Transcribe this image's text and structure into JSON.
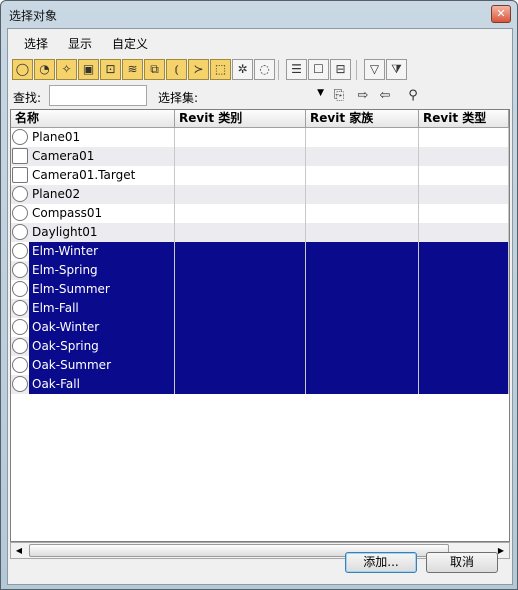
{
  "window": {
    "title": "选择对象",
    "close_glyph": "✕"
  },
  "menu": [
    "选择",
    "显示",
    "自定义"
  ],
  "toolbar": {
    "buttons": [
      {
        "icon": "geometry-icon",
        "glyph": "◯",
        "on": true
      },
      {
        "icon": "shapes-icon",
        "glyph": "◔",
        "on": true
      },
      {
        "icon": "lights-icon",
        "glyph": "✧",
        "on": true
      },
      {
        "icon": "cameras-icon",
        "glyph": "▣",
        "on": true
      },
      {
        "icon": "helpers-icon",
        "glyph": "⊡",
        "on": true
      },
      {
        "icon": "space-warps-icon",
        "glyph": "≋",
        "on": true
      },
      {
        "icon": "groups-icon",
        "glyph": "⧉",
        "on": true
      },
      {
        "icon": "xrefs-icon",
        "glyph": "⦅",
        "on": true
      },
      {
        "icon": "bones-icon",
        "glyph": "≻",
        "on": true
      },
      {
        "icon": "containers-icon",
        "glyph": "⬚",
        "on": true
      },
      {
        "icon": "frozen-icon",
        "glyph": "✲",
        "on": false
      },
      {
        "icon": "hidden-icon",
        "glyph": "◌",
        "on": false
      },
      {
        "icon": "list-all-icon",
        "glyph": "☰",
        "on": false
      },
      {
        "icon": "list-none-icon",
        "glyph": "☐",
        "on": false
      },
      {
        "icon": "list-invert-icon",
        "glyph": "⊟",
        "on": false
      },
      {
        "icon": "filter-icon",
        "glyph": "▽",
        "on": false
      },
      {
        "icon": "filter-options-icon",
        "glyph": "⧩",
        "on": false
      }
    ]
  },
  "filter": {
    "find_label": "查找:",
    "find_value": "",
    "selset_label": "选择集:",
    "selset_value": ""
  },
  "columns": [
    "名称",
    "Revit 类别",
    "Revit 家族",
    "Revit 类型"
  ],
  "rows": [
    {
      "name": "Plane01",
      "icon": "geometry-icon",
      "selected": false
    },
    {
      "name": "Camera01",
      "icon": "camera-icon",
      "selected": false
    },
    {
      "name": "Camera01.Target",
      "icon": "camera-target-icon",
      "selected": false
    },
    {
      "name": "Plane02",
      "icon": "geometry-icon",
      "selected": false
    },
    {
      "name": "Compass01",
      "icon": "helper-icon",
      "selected": false
    },
    {
      "name": "Daylight01",
      "icon": "group-icon",
      "selected": false
    },
    {
      "name": "Elm-Winter",
      "icon": "geometry-icon",
      "selected": true
    },
    {
      "name": "Elm-Spring",
      "icon": "geometry-icon",
      "selected": true
    },
    {
      "name": "Elm-Summer",
      "icon": "geometry-icon",
      "selected": true
    },
    {
      "name": "Elm-Fall",
      "icon": "geometry-icon",
      "selected": true
    },
    {
      "name": "Oak-Winter",
      "icon": "geometry-icon",
      "selected": true
    },
    {
      "name": "Oak-Spring",
      "icon": "geometry-icon",
      "selected": true
    },
    {
      "name": "Oak-Summer",
      "icon": "geometry-icon",
      "selected": true
    },
    {
      "name": "Oak-Fall",
      "icon": "geometry-icon",
      "selected": true
    }
  ],
  "buttons": {
    "add": "添加...",
    "cancel": "取消"
  }
}
